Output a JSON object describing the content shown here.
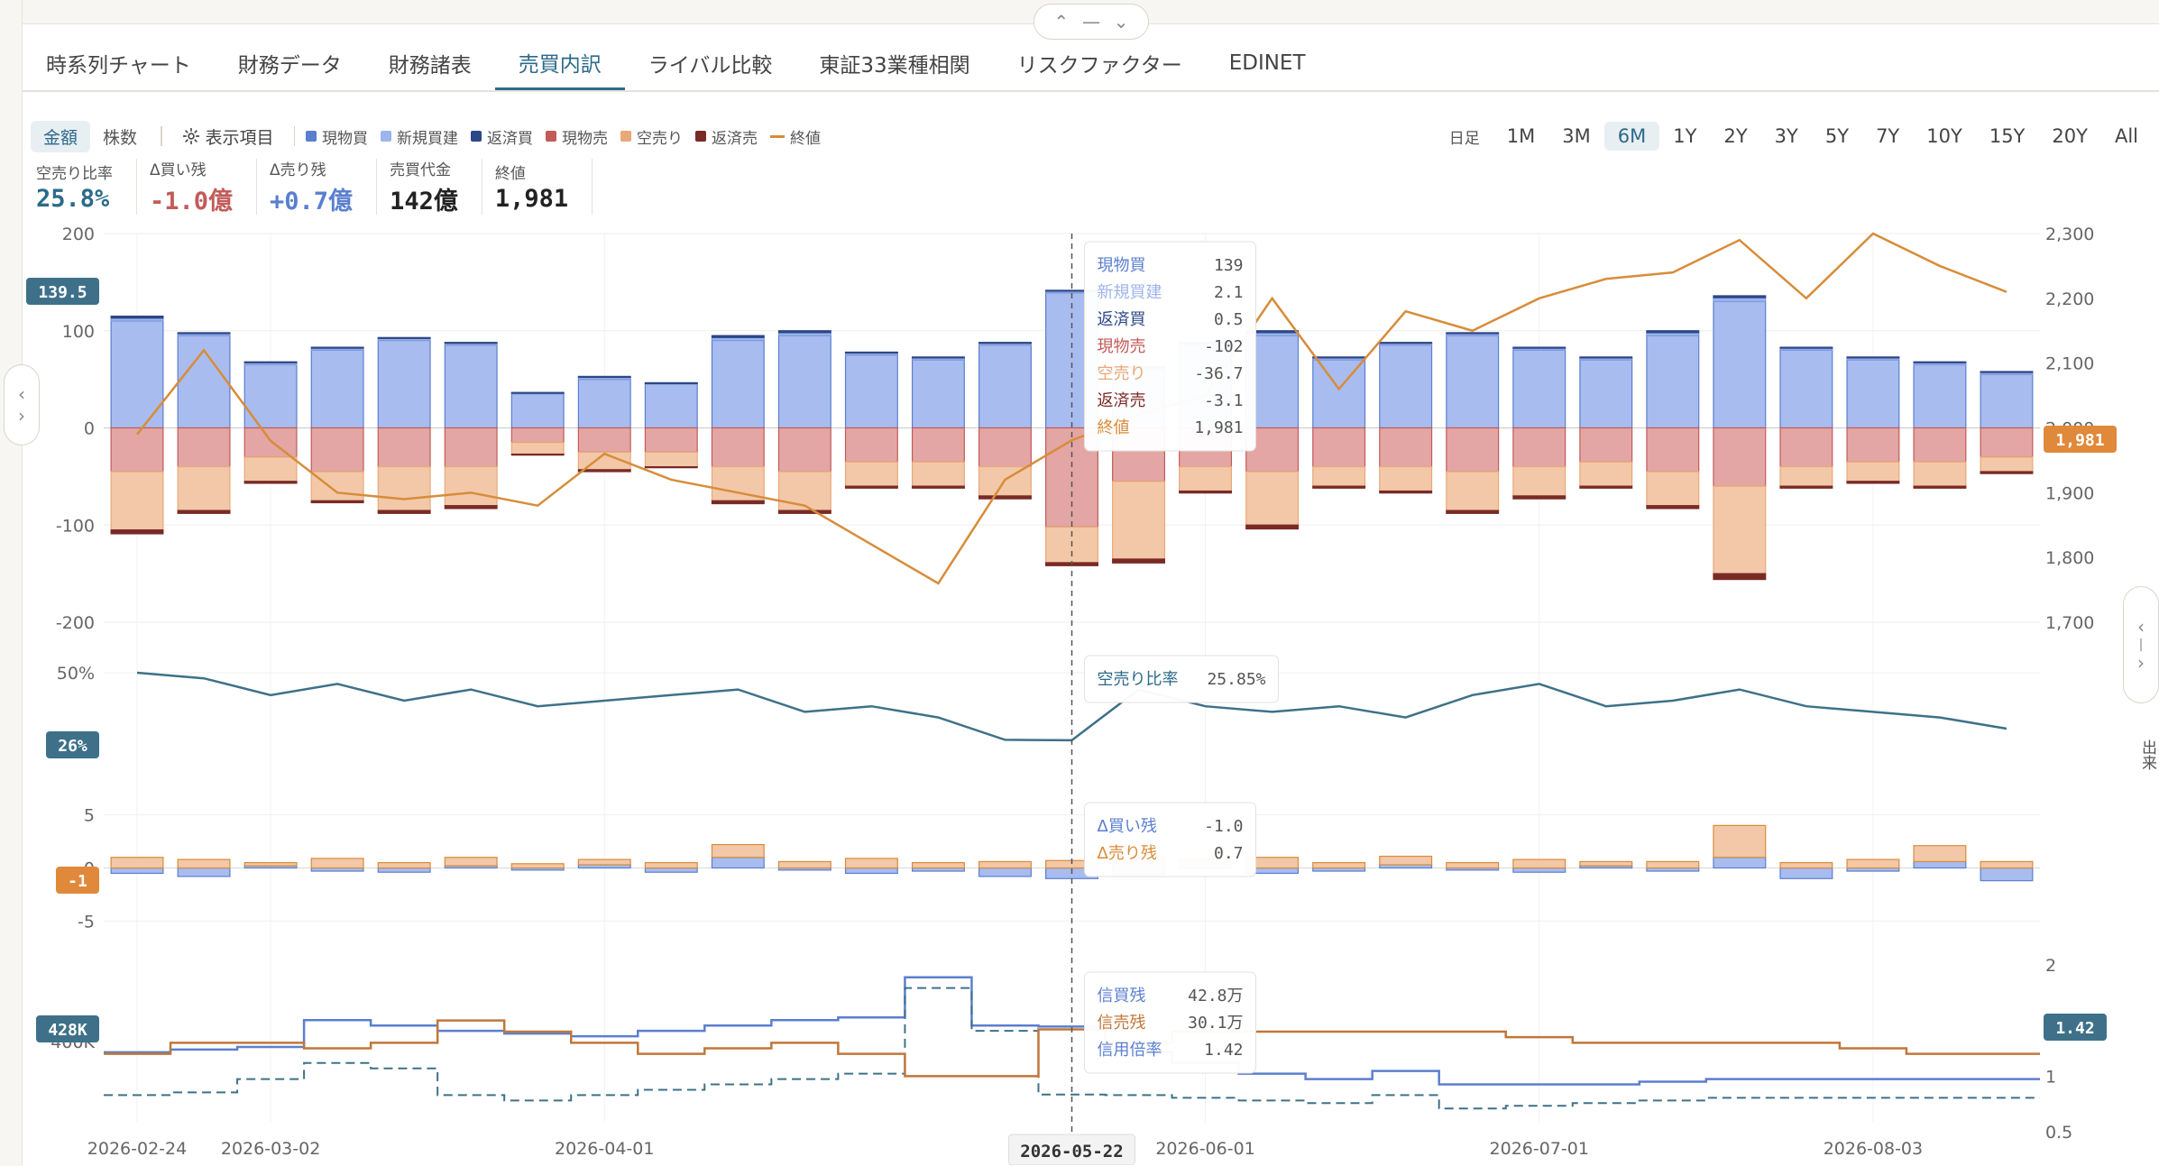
{
  "tabs": [
    {
      "label": "時系列チャート"
    },
    {
      "label": "財務データ"
    },
    {
      "label": "財務諸表"
    },
    {
      "label": "売買内訳",
      "active": true
    },
    {
      "label": "ライバル比較"
    },
    {
      "label": "東証33業種相関"
    },
    {
      "label": "リスクファクター"
    },
    {
      "label": "EDINET"
    }
  ],
  "controls": {
    "amount_label": "金額",
    "shares_label": "株数",
    "display_items_label": "表示項目"
  },
  "legend": [
    {
      "label": "現物買",
      "color": "#5b7fcf",
      "kind": "box"
    },
    {
      "label": "新規買建",
      "color": "#9db4ec",
      "kind": "box"
    },
    {
      "label": "返済買",
      "color": "#2d4787",
      "kind": "box"
    },
    {
      "label": "現物売",
      "color": "#c25b59",
      "kind": "box"
    },
    {
      "label": "空売り",
      "color": "#e8a878",
      "kind": "box"
    },
    {
      "label": "返済売",
      "color": "#7a2a26",
      "kind": "box"
    },
    {
      "label": "終値",
      "color": "#d88c3a",
      "kind": "line"
    }
  ],
  "ranges": [
    {
      "label": "日足"
    },
    {
      "label": "1M"
    },
    {
      "label": "3M"
    },
    {
      "label": "6M",
      "active": true
    },
    {
      "label": "1Y"
    },
    {
      "label": "2Y"
    },
    {
      "label": "3Y"
    },
    {
      "label": "5Y"
    },
    {
      "label": "7Y"
    },
    {
      "label": "10Y"
    },
    {
      "label": "15Y"
    },
    {
      "label": "20Y"
    },
    {
      "label": "All"
    }
  ],
  "stats": [
    {
      "label": "空売り比率",
      "value": "25.8%",
      "color": "#2c6a8a"
    },
    {
      "label": "Δ買い残",
      "value": "-1.0億",
      "color": "#c25b59"
    },
    {
      "label": "Δ売り残",
      "value": "+0.7億",
      "color": "#5b7fcf"
    },
    {
      "label": "売買代金",
      "value": "142億",
      "color": "#222222"
    },
    {
      "label": "終値",
      "value": "1,981",
      "color": "#222222"
    }
  ],
  "right_axis_label": "出来",
  "chart_data": [
    {
      "type": "bar",
      "panel": "trading breakdown",
      "x_axis_type": "date",
      "x_dates": [
        "2026-02-24",
        "2026-02-26",
        "2026-03-02",
        "2026-03-06",
        "2026-03-12",
        "2026-03-17",
        "2026-03-24",
        "2026-04-01",
        "2026-04-08",
        "2026-04-15",
        "2026-04-22",
        "2026-04-30",
        "2026-05-08",
        "2026-05-15",
        "2026-05-22",
        "2026-05-29",
        "2026-06-01",
        "2026-06-08",
        "2026-06-15",
        "2026-06-22",
        "2026-06-29",
        "2026-07-01",
        "2026-07-08",
        "2026-07-15",
        "2026-07-22",
        "2026-07-29",
        "2026-08-03",
        "2026-08-10",
        "2026-08-17"
      ],
      "x_ticks": [
        "2026-02-24",
        "2026-03-02",
        "2026-04-01",
        "2026-05-22",
        "2026-06-01",
        "2026-07-01",
        "2026-08-03"
      ],
      "ylim": [
        -200,
        200
      ],
      "y_ticks": [
        200,
        100,
        0,
        -100,
        -200
      ],
      "y2lim": [
        1700,
        2300
      ],
      "y2_ticks": [
        2300,
        2200,
        2100,
        2000,
        1900,
        1800,
        1700
      ],
      "series": [
        {
          "name": "現物買",
          "values": [
            110,
            95,
            65,
            80,
            90,
            85,
            35,
            50,
            45,
            90,
            95,
            75,
            70,
            85,
            139,
            60,
            85,
            95,
            70,
            85,
            95,
            80,
            70,
            95,
            130,
            80,
            70,
            65,
            55
          ]
        },
        {
          "name": "新規買建",
          "values": [
            3,
            2,
            2,
            2,
            2,
            2,
            1,
            2,
            1,
            3,
            3,
            2,
            2,
            2,
            2.1,
            2,
            2,
            3,
            2,
            2,
            2,
            2,
            2,
            3,
            4,
            2,
            2,
            2,
            2
          ]
        },
        {
          "name": "返済買",
          "values": [
            2,
            1,
            1,
            1,
            1,
            1,
            0.5,
            1,
            0.5,
            2,
            2,
            1,
            1,
            1,
            0.5,
            1,
            1,
            2,
            1,
            1,
            1,
            1,
            1,
            2,
            2,
            1,
            1,
            1,
            1
          ]
        },
        {
          "name": "現物売",
          "values": [
            -45,
            -40,
            -30,
            -45,
            -40,
            -40,
            -15,
            -25,
            -25,
            -40,
            -45,
            -35,
            -35,
            -40,
            -102,
            -55,
            -40,
            -45,
            -40,
            -40,
            -45,
            -40,
            -35,
            -45,
            -60,
            -40,
            -35,
            -35,
            -30
          ]
        },
        {
          "name": "空売り",
          "values": [
            -60,
            -45,
            -25,
            -30,
            -45,
            -40,
            -12,
            -18,
            -15,
            -35,
            -40,
            -25,
            -25,
            -30,
            -36.7,
            -80,
            -25,
            -55,
            -20,
            -25,
            -40,
            -30,
            -25,
            -35,
            -90,
            -20,
            -20,
            -25,
            -15
          ]
        },
        {
          "name": "返済売",
          "values": [
            -4,
            -3,
            -2,
            -2,
            -3,
            -3,
            -1,
            -2,
            -1,
            -3,
            -3,
            -2,
            -2,
            -3,
            -3.1,
            -4,
            -2,
            -4,
            -2,
            -2,
            -3,
            -3,
            -2,
            -3,
            -6,
            -2,
            -2,
            -2,
            -2
          ]
        },
        {
          "name": "終値",
          "axis": "y2",
          "values": [
            1990,
            2120,
            1980,
            1900,
            1890,
            1900,
            1880,
            1960,
            1920,
            1900,
            1880,
            1820,
            1760,
            1920,
            1981,
            2020,
            2050,
            2200,
            2060,
            2180,
            2150,
            2200,
            2230,
            2240,
            2290,
            2200,
            2300,
            2250,
            2210
          ]
        }
      ],
      "hover": {
        "date": "2026-05-22",
        "rows": [
          {
            "label": "現物買",
            "value": "139",
            "color": "#5b7fcf"
          },
          {
            "label": "新規買建",
            "value": "2.1",
            "color": "#9db4ec"
          },
          {
            "label": "返済買",
            "value": "0.5",
            "color": "#2d4787"
          },
          {
            "label": "現物売",
            "value": "-102",
            "color": "#c25b59"
          },
          {
            "label": "空売り",
            "value": "-36.7",
            "color": "#e8a878"
          },
          {
            "label": "返済売",
            "value": "-3.1",
            "color": "#7a2a26"
          },
          {
            "label": "終値",
            "value": "1,981",
            "color": "#d88c3a"
          }
        ]
      },
      "left_badge": "139.5",
      "right_badge": "1,981"
    },
    {
      "type": "line",
      "panel": "short ratio",
      "series": [
        {
          "name": "空売り比率",
          "values": [
            0.5,
            0.48,
            0.42,
            0.46,
            0.4,
            0.44,
            0.38,
            0.4,
            0.42,
            0.44,
            0.36,
            0.38,
            0.34,
            0.26,
            0.2585,
            0.44,
            0.38,
            0.36,
            0.38,
            0.34,
            0.42,
            0.46,
            0.38,
            0.4,
            0.44,
            0.38,
            0.36,
            0.34,
            0.3
          ]
        }
      ],
      "y_ticks": [
        "50%"
      ],
      "ylim": [
        0.1,
        0.6
      ],
      "hover": {
        "rows": [
          {
            "label": "空売り比率",
            "value": "25.85%",
            "color": "#2c6a8a"
          }
        ]
      },
      "left_badge": "26%"
    },
    {
      "type": "bar",
      "panel": "margin delta",
      "series": [
        {
          "name": "Δ買い残",
          "values": [
            -0.5,
            -0.8,
            0.2,
            -0.3,
            -0.4,
            0.2,
            -0.2,
            0.3,
            -0.4,
            1.0,
            -0.2,
            -0.5,
            -0.3,
            -0.8,
            -1.0,
            -0.6,
            0.3,
            -0.5,
            -0.3,
            0.3,
            -0.2,
            -0.4,
            0.2,
            -0.3,
            1.0,
            -1.0,
            -0.3,
            0.6,
            -1.2
          ]
        },
        {
          "name": "Δ売り残",
          "values": [
            1.0,
            0.8,
            0.3,
            0.9,
            0.5,
            0.8,
            0.4,
            0.5,
            0.5,
            1.2,
            0.6,
            0.9,
            0.5,
            0.6,
            0.7,
            1.0,
            0.5,
            1.0,
            0.5,
            0.8,
            0.5,
            0.8,
            0.4,
            0.6,
            3.0,
            0.5,
            0.8,
            1.5,
            0.6
          ]
        }
      ],
      "y_ticks": [
        5,
        0,
        -5
      ],
      "ylim": [
        -7,
        7
      ],
      "hover": {
        "rows": [
          {
            "label": "Δ買い残",
            "value": "-1.0",
            "color": "#5b7fcf"
          },
          {
            "label": "Δ売り残",
            "value": "0.7",
            "color": "#d88c3a"
          }
        ]
      },
      "left_badge": "-1"
    },
    {
      "type": "line",
      "panel": "margin balance",
      "y_ticks": [
        "400K"
      ],
      "y2_ticks": [
        2,
        1,
        0.5
      ],
      "series": [
        {
          "name": "信買残",
          "values": [
            380,
            385,
            390,
            440,
            430,
            420,
            415,
            410,
            420,
            430,
            440,
            445,
            520,
            430,
            428,
            380,
            360,
            340,
            330,
            345,
            320,
            320,
            320,
            325,
            330,
            330,
            330,
            330,
            330
          ]
        },
        {
          "name": "信売残",
          "values": [
            300,
            305,
            330,
            360,
            350,
            300,
            290,
            300,
            310,
            320,
            330,
            340,
            500,
            420,
            301,
            300,
            295,
            290,
            285,
            300,
            275,
            280,
            285,
            290,
            295,
            295,
            295,
            295,
            295
          ]
        },
        {
          "name": "信用倍率",
          "axis": "y2",
          "values": [
            1.2,
            1.3,
            1.3,
            1.25,
            1.3,
            1.5,
            1.4,
            1.3,
            1.2,
            1.25,
            1.3,
            1.2,
            1.0,
            1.0,
            1.42,
            1.3,
            1.4,
            1.4,
            1.4,
            1.4,
            1.4,
            1.35,
            1.3,
            1.3,
            1.3,
            1.3,
            1.25,
            1.2,
            1.2
          ]
        }
      ],
      "hover": {
        "rows": [
          {
            "label": "信買残",
            "value": "42.8万",
            "color": "#5b7fcf"
          },
          {
            "label": "信売残",
            "value": "30.1万",
            "color": "#c0773a"
          },
          {
            "label": "信用倍率",
            "value": "1.42",
            "color": "#5b7fcf"
          }
        ]
      },
      "left_badge": "428K",
      "right_badge": "1.42"
    }
  ]
}
